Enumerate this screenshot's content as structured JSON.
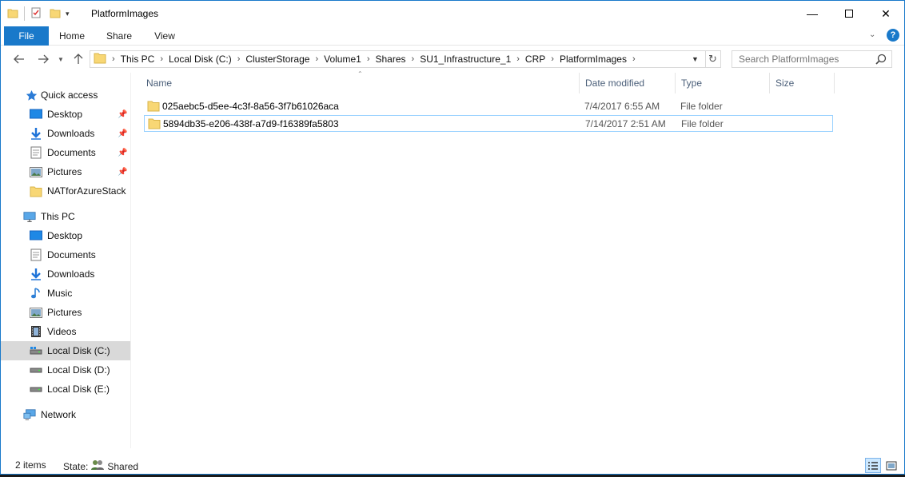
{
  "window": {
    "title": "PlatformImages",
    "controls": {
      "minimize": "—",
      "close": "✕"
    }
  },
  "ribbon": {
    "tabs": [
      "File",
      "Home",
      "Share",
      "View"
    ],
    "help": "?"
  },
  "address": {
    "crumbs": [
      "This PC",
      "Local Disk (C:)",
      "ClusterStorage",
      "Volume1",
      "Shares",
      "SU1_Infrastructure_1",
      "CRP",
      "PlatformImages"
    ]
  },
  "search": {
    "placeholder": "Search PlatformImages"
  },
  "sidebar": {
    "quick_access": {
      "label": "Quick access",
      "items": [
        {
          "label": "Desktop",
          "icon": "desktop-icon",
          "pinned": true
        },
        {
          "label": "Downloads",
          "icon": "downloads-icon",
          "pinned": true
        },
        {
          "label": "Documents",
          "icon": "documents-icon",
          "pinned": true
        },
        {
          "label": "Pictures",
          "icon": "pictures-icon",
          "pinned": true
        },
        {
          "label": "NATforAzureStack",
          "icon": "folder-icon",
          "pinned": false
        }
      ]
    },
    "this_pc": {
      "label": "This PC",
      "items": [
        {
          "label": "Desktop",
          "icon": "desktop-icon"
        },
        {
          "label": "Documents",
          "icon": "documents-icon"
        },
        {
          "label": "Downloads",
          "icon": "downloads-icon"
        },
        {
          "label": "Music",
          "icon": "music-icon"
        },
        {
          "label": "Pictures",
          "icon": "pictures-icon"
        },
        {
          "label": "Videos",
          "icon": "videos-icon"
        },
        {
          "label": "Local Disk (C:)",
          "icon": "drive-icon",
          "selected": true
        },
        {
          "label": "Local Disk (D:)",
          "icon": "drive-icon"
        },
        {
          "label": "Local Disk (E:)",
          "icon": "drive-icon"
        }
      ]
    },
    "network": {
      "label": "Network"
    }
  },
  "columns": {
    "name": "Name",
    "date": "Date modified",
    "type": "Type",
    "size": "Size"
  },
  "files": [
    {
      "name": "025aebc5-d5ee-4c3f-8a56-3f7b61026aca",
      "date": "7/4/2017 6:55 AM",
      "type": "File folder"
    },
    {
      "name": "5894db35-e206-438f-a7d9-f16389fa5803",
      "date": "7/14/2017 2:51 AM",
      "type": "File folder"
    }
  ],
  "status": {
    "count": "2 items",
    "state_label": "State:",
    "state_value": "Shared"
  },
  "colors": {
    "accent": "#1979ca",
    "folder": "#f8d775",
    "selection": "#99d1ff"
  }
}
